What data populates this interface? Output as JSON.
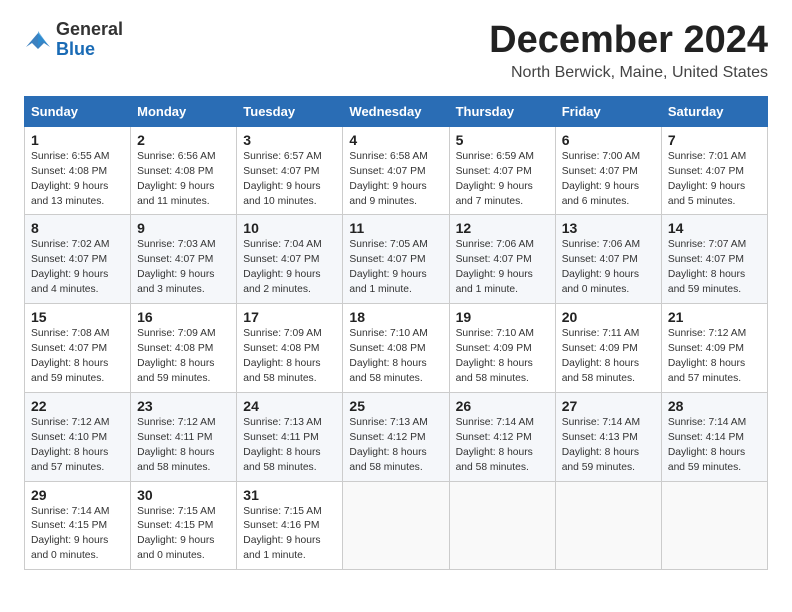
{
  "header": {
    "logo_general": "General",
    "logo_blue": "Blue",
    "title": "December 2024",
    "subtitle": "North Berwick, Maine, United States"
  },
  "days_of_week": [
    "Sunday",
    "Monday",
    "Tuesday",
    "Wednesday",
    "Thursday",
    "Friday",
    "Saturday"
  ],
  "weeks": [
    [
      {
        "day": "1",
        "info": "Sunrise: 6:55 AM\nSunset: 4:08 PM\nDaylight: 9 hours\nand 13 minutes."
      },
      {
        "day": "2",
        "info": "Sunrise: 6:56 AM\nSunset: 4:08 PM\nDaylight: 9 hours\nand 11 minutes."
      },
      {
        "day": "3",
        "info": "Sunrise: 6:57 AM\nSunset: 4:07 PM\nDaylight: 9 hours\nand 10 minutes."
      },
      {
        "day": "4",
        "info": "Sunrise: 6:58 AM\nSunset: 4:07 PM\nDaylight: 9 hours\nand 9 minutes."
      },
      {
        "day": "5",
        "info": "Sunrise: 6:59 AM\nSunset: 4:07 PM\nDaylight: 9 hours\nand 7 minutes."
      },
      {
        "day": "6",
        "info": "Sunrise: 7:00 AM\nSunset: 4:07 PM\nDaylight: 9 hours\nand 6 minutes."
      },
      {
        "day": "7",
        "info": "Sunrise: 7:01 AM\nSunset: 4:07 PM\nDaylight: 9 hours\nand 5 minutes."
      }
    ],
    [
      {
        "day": "8",
        "info": "Sunrise: 7:02 AM\nSunset: 4:07 PM\nDaylight: 9 hours\nand 4 minutes."
      },
      {
        "day": "9",
        "info": "Sunrise: 7:03 AM\nSunset: 4:07 PM\nDaylight: 9 hours\nand 3 minutes."
      },
      {
        "day": "10",
        "info": "Sunrise: 7:04 AM\nSunset: 4:07 PM\nDaylight: 9 hours\nand 2 minutes."
      },
      {
        "day": "11",
        "info": "Sunrise: 7:05 AM\nSunset: 4:07 PM\nDaylight: 9 hours\nand 1 minute."
      },
      {
        "day": "12",
        "info": "Sunrise: 7:06 AM\nSunset: 4:07 PM\nDaylight: 9 hours\nand 1 minute."
      },
      {
        "day": "13",
        "info": "Sunrise: 7:06 AM\nSunset: 4:07 PM\nDaylight: 9 hours\nand 0 minutes."
      },
      {
        "day": "14",
        "info": "Sunrise: 7:07 AM\nSunset: 4:07 PM\nDaylight: 8 hours\nand 59 minutes."
      }
    ],
    [
      {
        "day": "15",
        "info": "Sunrise: 7:08 AM\nSunset: 4:07 PM\nDaylight: 8 hours\nand 59 minutes."
      },
      {
        "day": "16",
        "info": "Sunrise: 7:09 AM\nSunset: 4:08 PM\nDaylight: 8 hours\nand 59 minutes."
      },
      {
        "day": "17",
        "info": "Sunrise: 7:09 AM\nSunset: 4:08 PM\nDaylight: 8 hours\nand 58 minutes."
      },
      {
        "day": "18",
        "info": "Sunrise: 7:10 AM\nSunset: 4:08 PM\nDaylight: 8 hours\nand 58 minutes."
      },
      {
        "day": "19",
        "info": "Sunrise: 7:10 AM\nSunset: 4:09 PM\nDaylight: 8 hours\nand 58 minutes."
      },
      {
        "day": "20",
        "info": "Sunrise: 7:11 AM\nSunset: 4:09 PM\nDaylight: 8 hours\nand 58 minutes."
      },
      {
        "day": "21",
        "info": "Sunrise: 7:12 AM\nSunset: 4:09 PM\nDaylight: 8 hours\nand 57 minutes."
      }
    ],
    [
      {
        "day": "22",
        "info": "Sunrise: 7:12 AM\nSunset: 4:10 PM\nDaylight: 8 hours\nand 57 minutes."
      },
      {
        "day": "23",
        "info": "Sunrise: 7:12 AM\nSunset: 4:11 PM\nDaylight: 8 hours\nand 58 minutes."
      },
      {
        "day": "24",
        "info": "Sunrise: 7:13 AM\nSunset: 4:11 PM\nDaylight: 8 hours\nand 58 minutes."
      },
      {
        "day": "25",
        "info": "Sunrise: 7:13 AM\nSunset: 4:12 PM\nDaylight: 8 hours\nand 58 minutes."
      },
      {
        "day": "26",
        "info": "Sunrise: 7:14 AM\nSunset: 4:12 PM\nDaylight: 8 hours\nand 58 minutes."
      },
      {
        "day": "27",
        "info": "Sunrise: 7:14 AM\nSunset: 4:13 PM\nDaylight: 8 hours\nand 59 minutes."
      },
      {
        "day": "28",
        "info": "Sunrise: 7:14 AM\nSunset: 4:14 PM\nDaylight: 8 hours\nand 59 minutes."
      }
    ],
    [
      {
        "day": "29",
        "info": "Sunrise: 7:14 AM\nSunset: 4:15 PM\nDaylight: 9 hours\nand 0 minutes."
      },
      {
        "day": "30",
        "info": "Sunrise: 7:15 AM\nSunset: 4:15 PM\nDaylight: 9 hours\nand 0 minutes."
      },
      {
        "day": "31",
        "info": "Sunrise: 7:15 AM\nSunset: 4:16 PM\nDaylight: 9 hours\nand 1 minute."
      },
      {
        "day": "",
        "info": ""
      },
      {
        "day": "",
        "info": ""
      },
      {
        "day": "",
        "info": ""
      },
      {
        "day": "",
        "info": ""
      }
    ]
  ]
}
